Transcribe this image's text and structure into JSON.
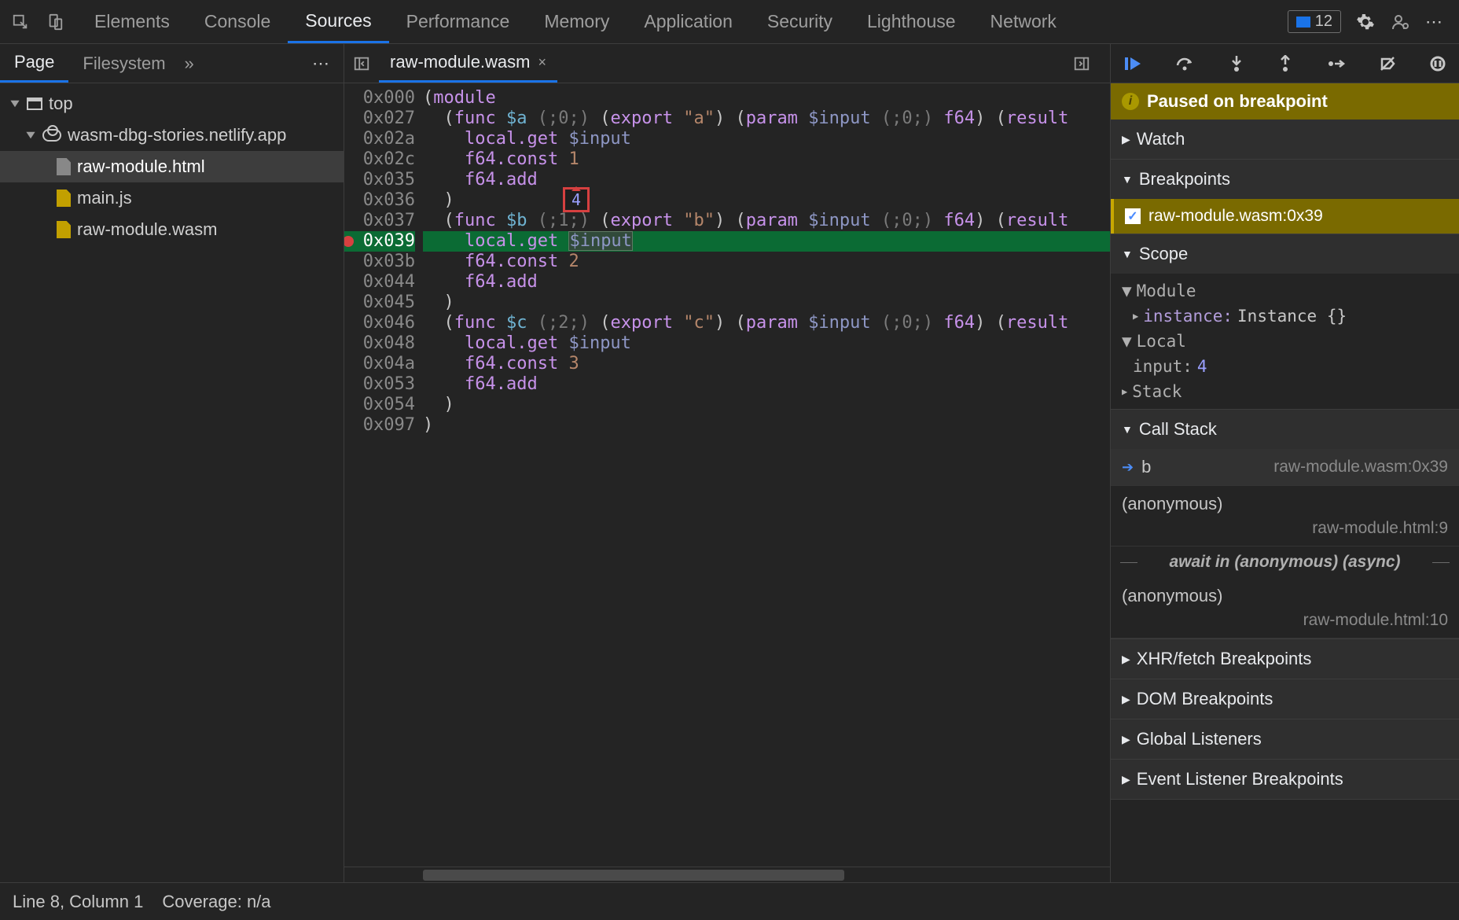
{
  "toolbar": {
    "tabs": [
      "Elements",
      "Console",
      "Sources",
      "Performance",
      "Memory",
      "Application",
      "Security",
      "Lighthouse",
      "Network"
    ],
    "active_tab": "Sources",
    "issue_count": "12"
  },
  "navigator": {
    "tabs": [
      "Page",
      "Filesystem"
    ],
    "active_tab": "Page",
    "tree": {
      "top": "top",
      "origin": "wasm-dbg-stories.netlify.app",
      "files": [
        "raw-module.html",
        "main.js",
        "raw-module.wasm"
      ],
      "selected": "raw-module.html"
    }
  },
  "editor": {
    "open_tab": "raw-module.wasm",
    "tooltip_value": "4",
    "gutter": [
      "0x000",
      "0x027",
      "0x02a",
      "0x02c",
      "0x035",
      "0x036",
      "0x037",
      "0x039",
      "0x03b",
      "0x044",
      "0x045",
      "0x046",
      "0x048",
      "0x04a",
      "0x053",
      "0x054",
      "0x097"
    ],
    "highlight_index": 7,
    "lines": [
      [
        [
          "p",
          "("
        ],
        [
          "kw",
          "module"
        ]
      ],
      [
        [
          "p",
          "  ("
        ],
        [
          "kw",
          "func"
        ],
        [
          "p",
          " "
        ],
        [
          "fn",
          "$a"
        ],
        [
          "p",
          " "
        ],
        [
          "cm",
          "(;0;)"
        ],
        [
          "p",
          " ("
        ],
        [
          "kw",
          "export"
        ],
        [
          "p",
          " "
        ],
        [
          "str",
          "\"a\""
        ],
        [
          "p",
          ") ("
        ],
        [
          "kw",
          "param"
        ],
        [
          "p",
          " "
        ],
        [
          "var",
          "$input"
        ],
        [
          "p",
          " "
        ],
        [
          "cm",
          "(;0;)"
        ],
        [
          "p",
          " "
        ],
        [
          "kw",
          "f64"
        ],
        [
          "p",
          ") ("
        ],
        [
          "kw",
          "result"
        ]
      ],
      [
        [
          "p",
          "    "
        ],
        [
          "kw",
          "local.get"
        ],
        [
          "p",
          " "
        ],
        [
          "var",
          "$input"
        ]
      ],
      [
        [
          "p",
          "    "
        ],
        [
          "kw",
          "f64.const"
        ],
        [
          "p",
          " "
        ],
        [
          "num",
          "1"
        ]
      ],
      [
        [
          "p",
          "    "
        ],
        [
          "kw",
          "f64.add"
        ]
      ],
      [
        [
          "p",
          "  )"
        ]
      ],
      [
        [
          "p",
          "  ("
        ],
        [
          "kw",
          "func"
        ],
        [
          "p",
          " "
        ],
        [
          "fn",
          "$b"
        ],
        [
          "p",
          " "
        ],
        [
          "cm",
          "(;1;)"
        ],
        [
          "p",
          " ("
        ],
        [
          "kw",
          "export"
        ],
        [
          "p",
          " "
        ],
        [
          "str",
          "\"b\""
        ],
        [
          "p",
          ") ("
        ],
        [
          "kw",
          "param"
        ],
        [
          "p",
          " "
        ],
        [
          "var",
          "$input"
        ],
        [
          "p",
          " "
        ],
        [
          "cm",
          "(;0;)"
        ],
        [
          "p",
          " "
        ],
        [
          "kw",
          "f64"
        ],
        [
          "p",
          ") ("
        ],
        [
          "kw",
          "result"
        ]
      ],
      [
        [
          "p",
          "    "
        ],
        [
          "kw",
          "local.get"
        ],
        [
          "p",
          " "
        ],
        [
          "sel",
          "$input"
        ]
      ],
      [
        [
          "p",
          "    "
        ],
        [
          "kw",
          "f64.const"
        ],
        [
          "p",
          " "
        ],
        [
          "num",
          "2"
        ]
      ],
      [
        [
          "p",
          "    "
        ],
        [
          "kw",
          "f64.add"
        ]
      ],
      [
        [
          "p",
          "  )"
        ]
      ],
      [
        [
          "p",
          "  ("
        ],
        [
          "kw",
          "func"
        ],
        [
          "p",
          " "
        ],
        [
          "fn",
          "$c"
        ],
        [
          "p",
          " "
        ],
        [
          "cm",
          "(;2;)"
        ],
        [
          "p",
          " ("
        ],
        [
          "kw",
          "export"
        ],
        [
          "p",
          " "
        ],
        [
          "str",
          "\"c\""
        ],
        [
          "p",
          ") ("
        ],
        [
          "kw",
          "param"
        ],
        [
          "p",
          " "
        ],
        [
          "var",
          "$input"
        ],
        [
          "p",
          " "
        ],
        [
          "cm",
          "(;0;)"
        ],
        [
          "p",
          " "
        ],
        [
          "kw",
          "f64"
        ],
        [
          "p",
          ") ("
        ],
        [
          "kw",
          "result"
        ]
      ],
      [
        [
          "p",
          "    "
        ],
        [
          "kw",
          "local.get"
        ],
        [
          "p",
          " "
        ],
        [
          "var",
          "$input"
        ]
      ],
      [
        [
          "p",
          "    "
        ],
        [
          "kw",
          "f64.const"
        ],
        [
          "p",
          " "
        ],
        [
          "num",
          "3"
        ]
      ],
      [
        [
          "p",
          "    "
        ],
        [
          "kw",
          "f64.add"
        ]
      ],
      [
        [
          "p",
          "  )"
        ]
      ],
      [
        [
          "p",
          ")"
        ]
      ]
    ]
  },
  "debugger": {
    "paused_message": "Paused on breakpoint",
    "sections": {
      "watch": "Watch",
      "breakpoints": "Breakpoints",
      "scope": "Scope",
      "callstack": "Call Stack",
      "xhr": "XHR/fetch Breakpoints",
      "dom": "DOM Breakpoints",
      "listeners": "Global Listeners",
      "events": "Event Listener Breakpoints"
    },
    "breakpoint_item": "raw-module.wasm:0x39",
    "scope": {
      "module_label": "Module",
      "instance_label": "instance:",
      "instance_value": "Instance {}",
      "local_label": "Local",
      "input_label": "input:",
      "input_value": "4",
      "stack_label": "Stack"
    },
    "callstack": [
      {
        "name": "b",
        "loc": "raw-module.wasm:0x39",
        "current": true
      },
      {
        "name": "(anonymous)",
        "loc": "raw-module.html:9"
      }
    ],
    "await_label": "await in (anonymous) (async)",
    "callstack2": [
      {
        "name": "(anonymous)",
        "loc": "raw-module.html:10"
      }
    ]
  },
  "status": {
    "position": "Line 8, Column 1",
    "coverage": "Coverage: n/a"
  }
}
